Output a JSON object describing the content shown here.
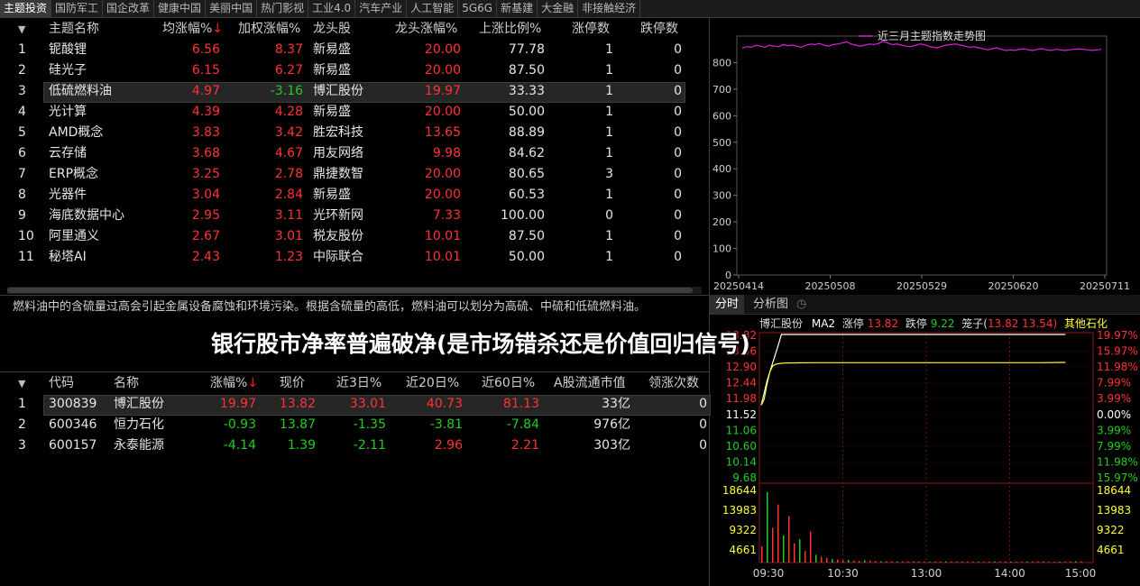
{
  "tabs": [
    "主题投资",
    "国防军工",
    "国企改革",
    "健康中国",
    "美丽中国",
    "热门影视",
    "工业4.0",
    "汽车产业",
    "人工智能",
    "5G6G",
    "新基建",
    "大金融",
    "非接触经济"
  ],
  "active_tab": 0,
  "theme_table": {
    "headers": [
      "主题名称",
      "均涨幅%",
      "加权涨幅%",
      "龙头股",
      "龙头涨幅%",
      "上涨比例%",
      "涨停数",
      "跌停数"
    ],
    "sort_arrow": "↓",
    "rows": [
      {
        "idx": "1",
        "name": "铌酸锂",
        "avg": "6.56",
        "wavg": "8.37",
        "lead": "新易盛",
        "lead_chg": "20.00",
        "up_ratio": "77.78",
        "limit_up": "1",
        "limit_down": "0"
      },
      {
        "idx": "2",
        "name": "硅光子",
        "avg": "6.15",
        "wavg": "6.27",
        "lead": "新易盛",
        "lead_chg": "20.00",
        "up_ratio": "87.50",
        "limit_up": "1",
        "limit_down": "0"
      },
      {
        "idx": "3",
        "name": "低硫燃料油",
        "avg": "4.97",
        "wavg": "-3.16",
        "lead": "博汇股份",
        "lead_chg": "19.97",
        "up_ratio": "33.33",
        "limit_up": "1",
        "limit_down": "0"
      },
      {
        "idx": "4",
        "name": "光计算",
        "avg": "4.39",
        "wavg": "4.28",
        "lead": "新易盛",
        "lead_chg": "20.00",
        "up_ratio": "50.00",
        "limit_up": "1",
        "limit_down": "0"
      },
      {
        "idx": "5",
        "name": "AMD概念",
        "avg": "3.83",
        "wavg": "3.42",
        "lead": "胜宏科技",
        "lead_chg": "13.65",
        "up_ratio": "88.89",
        "limit_up": "1",
        "limit_down": "0"
      },
      {
        "idx": "6",
        "name": "云存储",
        "avg": "3.68",
        "wavg": "4.67",
        "lead": "用友网络",
        "lead_chg": "9.98",
        "up_ratio": "84.62",
        "limit_up": "1",
        "limit_down": "0"
      },
      {
        "idx": "7",
        "name": "ERP概念",
        "avg": "3.25",
        "wavg": "2.78",
        "lead": "鼎捷数智",
        "lead_chg": "20.00",
        "up_ratio": "80.65",
        "limit_up": "3",
        "limit_down": "0"
      },
      {
        "idx": "8",
        "name": "光器件",
        "avg": "3.04",
        "wavg": "2.84",
        "lead": "新易盛",
        "lead_chg": "20.00",
        "up_ratio": "60.53",
        "limit_up": "1",
        "limit_down": "0"
      },
      {
        "idx": "9",
        "name": "海底数据中心",
        "avg": "2.95",
        "wavg": "3.11",
        "lead": "光环新网",
        "lead_chg": "7.33",
        "up_ratio": "100.00",
        "limit_up": "0",
        "limit_down": "0"
      },
      {
        "idx": "10",
        "name": "阿里通义",
        "avg": "2.67",
        "wavg": "3.01",
        "lead": "税友股份",
        "lead_chg": "10.01",
        "up_ratio": "87.50",
        "limit_up": "1",
        "limit_down": "0"
      },
      {
        "idx": "11",
        "name": "秘塔AI",
        "avg": "2.43",
        "wavg": "1.23",
        "lead": "中际联合",
        "lead_chg": "10.01",
        "up_ratio": "50.00",
        "limit_up": "1",
        "limit_down": "0"
      }
    ]
  },
  "description": "燃料油中的含硫量过高会引起金属设备腐蚀和环境污染。根据含硫量的高低，燃料油可以划分为高硫、中硫和低硫燃料油。",
  "overlay_text": "银行股市净率普遍破净(是市场错杀还是价值回归信号)",
  "stock_table": {
    "headers": [
      "代码",
      "名称",
      "涨幅%",
      "现价",
      "近3日%",
      "近20日%",
      "近60日%",
      "A股流通市值",
      "领涨次数"
    ],
    "rows": [
      {
        "idx": "1",
        "code": "300839",
        "name": "博汇股份",
        "chg": "19.97",
        "price": "13.82",
        "d3": "33.01",
        "d20": "40.73",
        "d60": "81.13",
        "cap": "33亿",
        "lead_times": "0"
      },
      {
        "idx": "2",
        "code": "600346",
        "name": "恒力石化",
        "chg": "-0.93",
        "price": "13.87",
        "d3": "-1.35",
        "d20": "-3.81",
        "d60": "-7.84",
        "cap": "976亿",
        "lead_times": "0"
      },
      {
        "idx": "3",
        "code": "600157",
        "name": "永泰能源",
        "chg": "-4.14",
        "price": "1.39",
        "d3": "-2.11",
        "d20": "2.96",
        "d60": "2.21",
        "cap": "303亿",
        "lead_times": "0"
      }
    ]
  },
  "chart_data": [
    {
      "type": "line",
      "title": "近三月主题指数走势图",
      "x_ticks": [
        "20250414",
        "20250508",
        "20250529",
        "20250620",
        "20250711"
      ],
      "y_ticks": [
        "0",
        "100",
        "200",
        "300",
        "400",
        "500",
        "600",
        "700",
        "800"
      ],
      "ylim": [
        0,
        900
      ],
      "series": [
        {
          "color": "#e020e0",
          "values": [
            855,
            860,
            858,
            865,
            862,
            858,
            865,
            862,
            860,
            868,
            864,
            866,
            862,
            858,
            865,
            870,
            868,
            872,
            866,
            862,
            868,
            870,
            874,
            878,
            870,
            866,
            862,
            866,
            870,
            868,
            872,
            880,
            874,
            868,
            870,
            866,
            862,
            860,
            864,
            870,
            868,
            862,
            858,
            856,
            862,
            866,
            868,
            870,
            866,
            862,
            858,
            860,
            856,
            852,
            848,
            852,
            856,
            850,
            846,
            848,
            846,
            850,
            852,
            848,
            846,
            850,
            852,
            848,
            846,
            850,
            848,
            846,
            848,
            850,
            852,
            850,
            848,
            846,
            848,
            850
          ]
        }
      ]
    },
    {
      "type": "line",
      "title": "博汇股份 MA2",
      "x_ticks": [
        "09:30",
        "10:30",
        "13:00",
        "14:00",
        "15:00"
      ],
      "price_ticks_left": [
        "13.82",
        "13.36",
        "12.90",
        "12.44",
        "11.98",
        "11.52",
        "11.06",
        "10.60",
        "10.14",
        "9.68"
      ],
      "pct_ticks_right": [
        "19.97%",
        "15.97%",
        "11.98%",
        "7.99%",
        "3.99%",
        "0.00%",
        "3.99%",
        "7.99%",
        "11.98%",
        "15.97%"
      ],
      "volume_ticks_left": [
        "18644",
        "13983",
        "9322",
        "4661"
      ],
      "volume_ticks_right": [
        "18644",
        "13983",
        "9322",
        "4661"
      ],
      "ylim": [
        9.22,
        13.82
      ],
      "legend": {
        "name": "博汇股份",
        "ma": "MA2",
        "up_label": "涨停",
        "up_val": "13.82",
        "down_label": "跌停",
        "down_val": "9.22",
        "cage_label": "笼子(",
        "cage_a": "13.82",
        "cage_b": "13.54)",
        "other": "其他石化"
      },
      "series": [
        {
          "name": "price",
          "color": "#ffffff",
          "values": [
            11.52,
            11.9,
            12.3,
            12.6,
            12.9,
            13.2,
            13.5,
            13.82,
            13.82,
            13.82,
            13.82,
            13.82,
            13.82,
            13.82,
            13.82,
            13.82,
            13.82,
            13.82,
            13.82,
            13.82
          ]
        },
        {
          "name": "avg",
          "color": "#ffff33",
          "values": [
            11.52,
            11.7,
            12.2,
            12.6,
            12.8,
            12.85,
            12.87,
            12.88,
            12.89,
            12.9,
            12.9,
            12.9,
            12.9,
            12.9,
            12.9,
            12.9,
            12.9,
            12.9,
            12.9,
            12.91
          ]
        }
      ],
      "volume": [
        4200,
        18200,
        9000,
        15000,
        7000,
        12000,
        5000,
        6000,
        3000,
        8000,
        2000,
        1500,
        1200,
        900,
        800,
        600,
        700,
        500,
        400,
        600,
        500,
        400,
        300,
        350,
        300,
        250,
        300,
        280,
        260,
        300,
        250,
        220,
        240,
        260,
        300,
        280,
        250,
        230,
        260,
        240,
        220,
        200,
        250,
        300,
        280,
        260,
        240,
        220,
        200,
        260,
        280,
        300,
        250,
        220,
        200,
        240,
        260,
        280,
        300,
        320
      ]
    }
  ],
  "chart_tabs": [
    "分时",
    "分析图"
  ]
}
